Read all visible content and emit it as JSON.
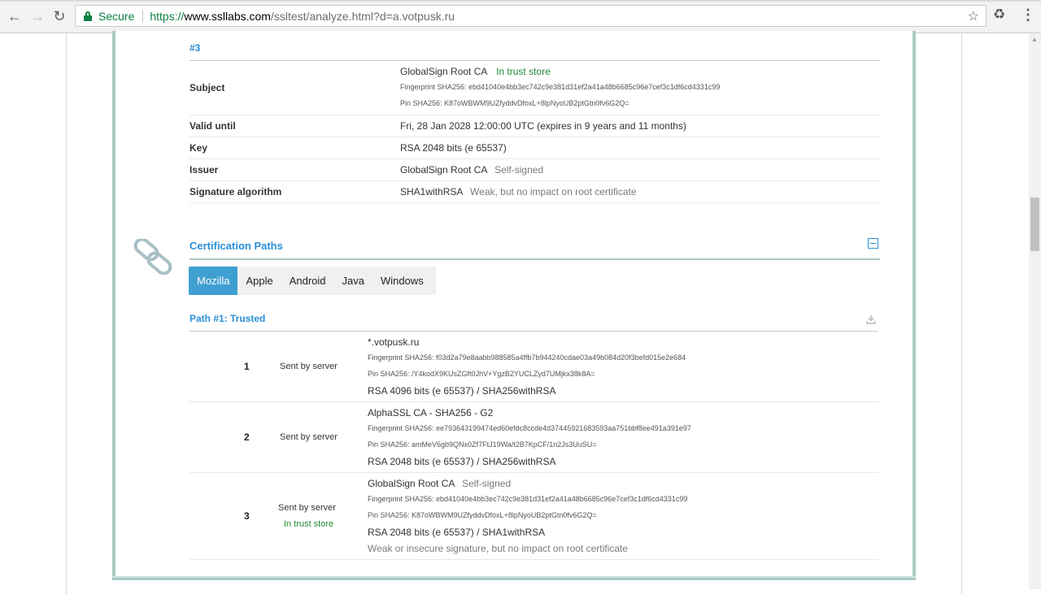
{
  "browser": {
    "secure_label": "Secure",
    "url_scheme": "https://",
    "url_host": "www.ssllabs.com",
    "url_path": "/ssltest/analyze.html?d=a.votpusk.ru"
  },
  "cert3": {
    "heading": "#3",
    "rows": {
      "subject": {
        "label": "Subject",
        "name": "GlobalSign Root CA",
        "status": "In trust store",
        "fingerprint": "Fingerprint SHA256: ebd41040e4bb3ec742c9e381d31ef2a41a48b6685c96e7cef3c1df6cd4331c99",
        "pin": "Pin SHA256: K87oWBWM9UZfyddvDfoxL+8lpNyoUB2ptGtn0fv6G2Q="
      },
      "valid_until": {
        "label": "Valid until",
        "value": "Fri, 28 Jan 2028 12:00:00 UTC (expires in 9 years and 11 months)"
      },
      "key": {
        "label": "Key",
        "value": "RSA 2048 bits (e 65537)"
      },
      "issuer": {
        "label": "Issuer",
        "value": "GlobalSign Root CA",
        "note": "Self-signed"
      },
      "signature": {
        "label": "Signature algorithm",
        "value": "SHA1withRSA",
        "note": "Weak, but no impact on root certificate"
      }
    }
  },
  "cert_paths": {
    "title": "Certification Paths",
    "tabs": [
      "Mozilla",
      "Apple",
      "Android",
      "Java",
      "Windows"
    ],
    "active_tab": "Mozilla",
    "path_title": "Path #1: Trusted",
    "entries": [
      {
        "num": "1",
        "sent": "Sent by server",
        "name": "*.votpusk.ru",
        "fingerprint": "Fingerprint SHA256: f03d2a79e8aabb988585a4ffb7b944240cdae03a49b084d20f3befd015e2e684",
        "pin": "Pin SHA256: /Y4kodX9KUsZGft0JhV+YgzB2YUCLZyd7UMjkx38k8A=",
        "key": "RSA 4096 bits (e 65537) / SHA256withRSA"
      },
      {
        "num": "2",
        "sent": "Sent by server",
        "name": "AlphaSSL CA - SHA256 - G2",
        "fingerprint": "Fingerprint SHA256: ee793643199474ed60efdc8ccde4d37445921683593aa751bbf8ee491a391e97",
        "pin": "Pin SHA256: amMeV6gb9QNx0Zf7FtJ19Wa/t2B7KpCF/1n2Js3UuSU=",
        "key": "RSA 2048 bits (e 65537) / SHA256withRSA"
      },
      {
        "num": "3",
        "sent": "Sent by server",
        "trust": "In trust store",
        "name": "GlobalSign Root CA",
        "name_note": "Self-signed",
        "fingerprint": "Fingerprint SHA256: ebd41040e4bb3ec742c9e381d31ef2a41a48b6685c96e7cef3c1df6cd4331c99",
        "pin": "Pin SHA256: K87oWBWM9UZfyddvDfoxL+8lpNyoUB2ptGtn0fv6G2Q=",
        "key": "RSA 2048 bits (e 65537) / SHA1withRSA",
        "note": "Weak or insecure signature, but no impact on root certificate"
      }
    ]
  },
  "colors": {
    "accent": "#2a8fd6",
    "frame": "#a9cbc6",
    "active_tab": "#3f9fd1",
    "ok": "#1f8a2f",
    "warn": "#e5731a"
  }
}
